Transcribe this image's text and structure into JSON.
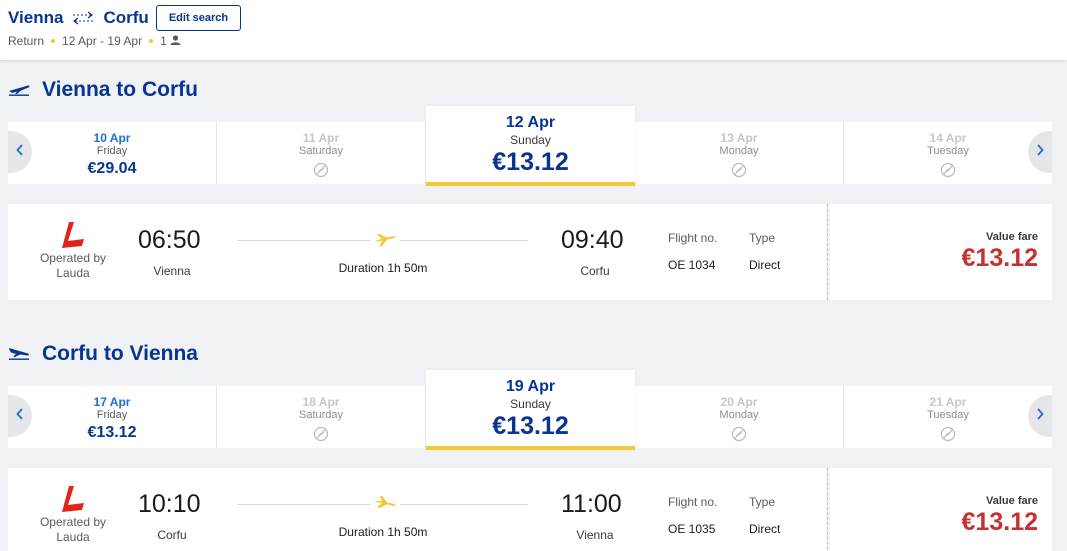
{
  "header": {
    "origin": "Vienna",
    "destination": "Corfu",
    "edit_label": "Edit search",
    "trip_type": "Return",
    "dates": "12 Apr - 19 Apr",
    "passengers": "1"
  },
  "outbound": {
    "title": "Vienna to Corfu",
    "dates": [
      {
        "date": "10 Apr",
        "weekday": "Friday",
        "price": "€29.04",
        "state": "available"
      },
      {
        "date": "11 Apr",
        "weekday": "Saturday",
        "price": "",
        "state": "disabled"
      },
      {
        "date": "12 Apr",
        "weekday": "Sunday",
        "price": "€13.12",
        "state": "selected"
      },
      {
        "date": "13 Apr",
        "weekday": "Monday",
        "price": "",
        "state": "disabled"
      },
      {
        "date": "14 Apr",
        "weekday": "Tuesday",
        "price": "",
        "state": "disabled"
      }
    ],
    "flight": {
      "operated_by": "Operated by Lauda",
      "depart_time": "06:50",
      "depart_city": "Vienna",
      "arrive_time": "09:40",
      "arrive_city": "Corfu",
      "duration": "Duration 1h 50m",
      "flight_no_label": "Flight no.",
      "flight_no": "OE 1034",
      "type_label": "Type",
      "type": "Direct",
      "fare_label": "Value fare",
      "fare_price": "€13.12"
    }
  },
  "inbound": {
    "title": "Corfu to Vienna",
    "dates": [
      {
        "date": "17 Apr",
        "weekday": "Friday",
        "price": "€13.12",
        "state": "available"
      },
      {
        "date": "18 Apr",
        "weekday": "Saturday",
        "price": "",
        "state": "disabled"
      },
      {
        "date": "19 Apr",
        "weekday": "Sunday",
        "price": "€13.12",
        "state": "selected"
      },
      {
        "date": "20 Apr",
        "weekday": "Monday",
        "price": "",
        "state": "disabled"
      },
      {
        "date": "21 Apr",
        "weekday": "Tuesday",
        "price": "",
        "state": "disabled"
      }
    ],
    "flight": {
      "operated_by": "Operated by Lauda",
      "depart_time": "10:10",
      "depart_city": "Corfu",
      "arrive_time": "11:00",
      "arrive_city": "Vienna",
      "duration": "Duration 1h 50m",
      "flight_no_label": "Flight no.",
      "flight_no": "OE 1035",
      "type_label": "Type",
      "type": "Direct",
      "fare_label": "Value fare",
      "fare_price": "€13.12"
    }
  },
  "colors": {
    "brand_blue": "#073590",
    "accent_yellow": "#f1c933",
    "price_red": "#c53030",
    "lauda_red": "#e2231a"
  },
  "icons": {
    "route": "swap-arrows-icon",
    "passenger": "person-icon",
    "departure": "plane-takeoff-icon",
    "arrival": "plane-landing-icon",
    "no_flight": "no-flight-icon",
    "nav_prev": "chevron-left-icon",
    "nav_next": "chevron-right-icon",
    "airline_logo": "lauda-logo"
  }
}
